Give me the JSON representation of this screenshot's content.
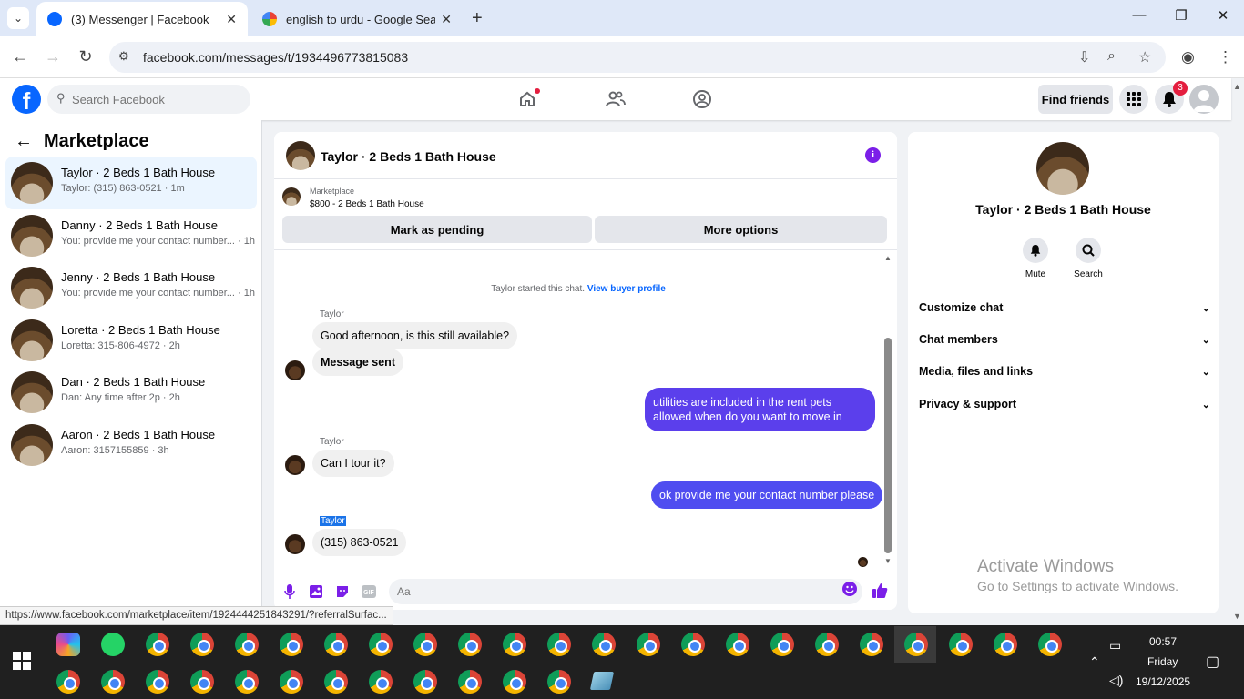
{
  "browser": {
    "tabs": [
      {
        "title": "(3) Messenger | Facebook"
      },
      {
        "title": "english to urdu - Google Search"
      }
    ],
    "url": "facebook.com/messages/t/1934496773815083",
    "status_url": "https://www.facebook.com/marketplace/item/1924444251843291/?referralSurfac..."
  },
  "fb": {
    "search_placeholder": "Search Facebook",
    "find_friends": "Find friends",
    "notif_count": "3"
  },
  "left": {
    "title": "Marketplace",
    "conversations": [
      {
        "name": "Taylor · 2 Beds 1 Bath House",
        "snippet": "Taylor: (315) 863-0521 · 1m"
      },
      {
        "name": "Danny · 2 Beds 1 Bath House",
        "snippet": "You: provide me your contact number... · 1h"
      },
      {
        "name": "Jenny · 2 Beds 1 Bath House",
        "snippet": "You: provide me your contact number... · 1h"
      },
      {
        "name": "Loretta · 2 Beds 1 Bath House",
        "snippet": "Loretta: 315-806-4972 · 2h"
      },
      {
        "name": "Dan · 2 Beds 1 Bath House",
        "snippet": "Dan: Any time after 2p · 2h"
      },
      {
        "name": "Aaron · 2 Beds 1 Bath House",
        "snippet": "Aaron: 3157155859 · 3h"
      }
    ]
  },
  "chat": {
    "title": "Taylor · 2 Beds 1 Bath House",
    "marketplace_label": "Marketplace",
    "listing": "$800 - 2 Beds 1 Bath House",
    "mark_pending": "Mark as pending",
    "more_options": "More options",
    "system_text": "Taylor started this chat.",
    "system_link": "View buyer profile",
    "messages": [
      {
        "sender": "Taylor",
        "text": "Good afternoon, is this still available?"
      },
      {
        "text": "Message sent"
      },
      {
        "text": "utilities are included in the rent pets allowed when do you want to move in"
      },
      {
        "sender": "Taylor",
        "text": "Can I tour it?"
      },
      {
        "text": "ok provide me your contact number please"
      },
      {
        "sender": "Taylor",
        "text": "(315) 863-0521"
      }
    ],
    "composer_placeholder": "Aa",
    "outgoing_color": "#5b3fec"
  },
  "right": {
    "name": "Taylor · 2 Beds 1 Bath House",
    "actions": [
      "Mute",
      "Search"
    ],
    "sections": [
      "Customize chat",
      "Chat members",
      "Media, files and links",
      "Privacy & support"
    ]
  },
  "watermark": {
    "line1": "Activate Windows",
    "line2": "Go to Settings to activate Windows."
  },
  "taskbar": {
    "time": "00:57",
    "day": "Friday",
    "date": "19/12/2025"
  }
}
